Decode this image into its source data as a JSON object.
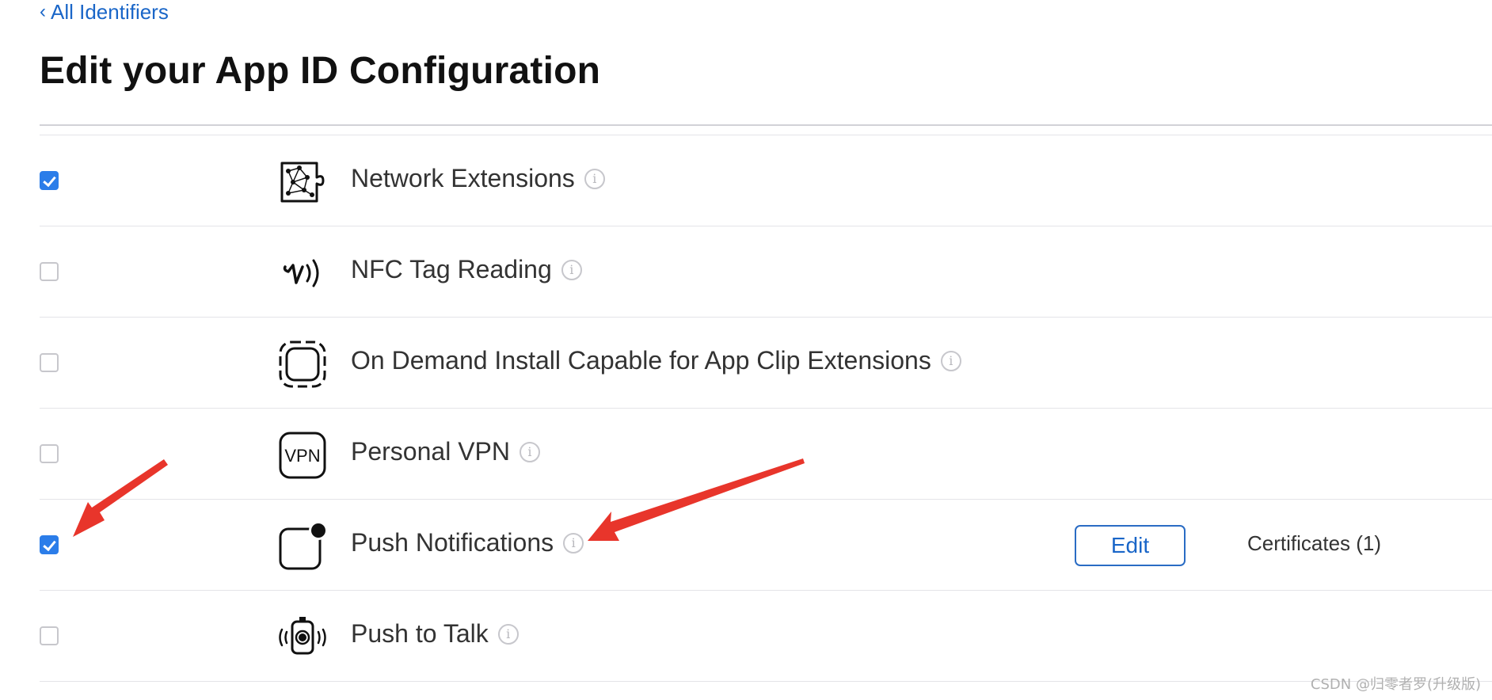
{
  "nav": {
    "back_chevron": "‹",
    "back_label": "All Identifiers"
  },
  "page": {
    "title": "Edit your App ID Configuration"
  },
  "capabilities": [
    {
      "label": "Network Extensions",
      "checked": true,
      "icon": "network-extensions-icon"
    },
    {
      "label": "NFC Tag Reading",
      "checked": false,
      "icon": "nfc-icon"
    },
    {
      "label": "On Demand Install Capable for App Clip Extensions",
      "checked": false,
      "icon": "app-clip-icon"
    },
    {
      "label": "Personal VPN",
      "checked": false,
      "icon": "vpn-icon",
      "icon_text": "VPN"
    },
    {
      "label": "Push Notifications",
      "checked": true,
      "icon": "push-notifications-icon",
      "edit_label": "Edit",
      "certificates_label": "Certificates (1)"
    },
    {
      "label": "Push to Talk",
      "checked": false,
      "icon": "push-to-talk-icon"
    }
  ],
  "info_glyph": "i",
  "colors": {
    "accent": "#2b7de9",
    "link": "#1a66c8",
    "annotation_arrow": "#e8352b"
  },
  "watermark": "CSDN @归零者罗(升级版)"
}
